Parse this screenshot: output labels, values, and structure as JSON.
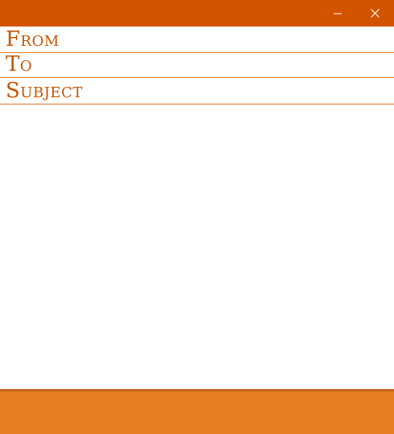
{
  "titlebar": {
    "color": "#d35400",
    "minimize_icon": "minimize-icon",
    "close_icon": "close-icon"
  },
  "fields": {
    "from_label": "From",
    "to_label": "To",
    "subject_label": "Subject",
    "from_value": "",
    "to_value": "",
    "subject_value": ""
  },
  "body": {
    "value": ""
  },
  "footer": {
    "color": "#e67e22"
  },
  "colors": {
    "accent": "#d35400",
    "label": "#c45500",
    "divider": "#e07a2a"
  }
}
